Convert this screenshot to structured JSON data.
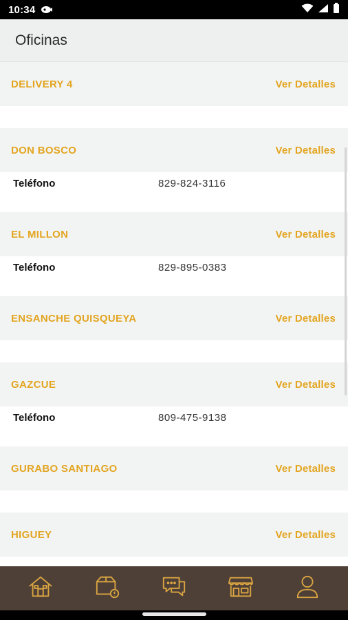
{
  "status_bar": {
    "time": "10:34"
  },
  "header": {
    "title": "Oficinas"
  },
  "offices": [
    {
      "name": "DELIVERY 4",
      "link": "Ver Detalles"
    },
    {
      "name": "DON BOSCO",
      "link": "Ver Detalles",
      "phone_label": "Teléfono",
      "phone": "829-824-3116"
    },
    {
      "name": "EL MILLON",
      "link": "Ver Detalles",
      "phone_label": "Teléfono",
      "phone": "829-895-0383"
    },
    {
      "name": "ENSANCHE QUISQUEYA",
      "link": "Ver Detalles"
    },
    {
      "name": "GAZCUE",
      "link": "Ver Detalles",
      "phone_label": "Teléfono",
      "phone": "809-475-9138"
    },
    {
      "name": "GURABO SANTIAGO",
      "link": "Ver Detalles"
    },
    {
      "name": "HIGUEY",
      "link": "Ver Detalles"
    }
  ],
  "bottom_nav": {
    "items": [
      {
        "icon": "home-icon"
      },
      {
        "icon": "package-icon"
      },
      {
        "icon": "chat-icon"
      },
      {
        "icon": "store-icon",
        "active": true
      },
      {
        "icon": "user-icon"
      }
    ]
  },
  "colors": {
    "accent": "#e3a521",
    "nav_background": "#4e4037",
    "header_background": "#eef0ef"
  }
}
